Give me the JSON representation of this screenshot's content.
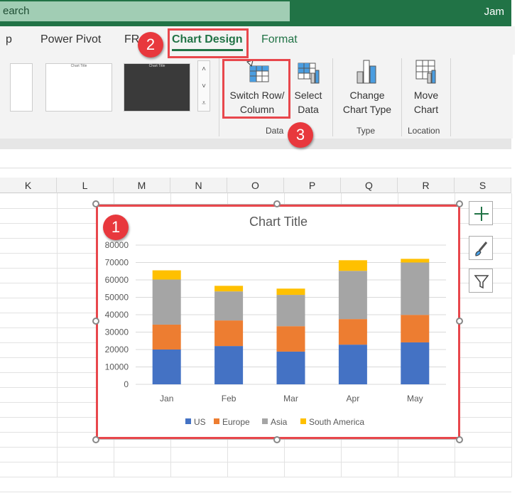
{
  "titlebar": {
    "search": "earch",
    "user": "Jam"
  },
  "tabs": [
    {
      "label": "p"
    },
    {
      "label": "Power Pivot"
    },
    {
      "label": "FR"
    },
    {
      "label": "Chart Design",
      "active": true
    },
    {
      "label": "Format"
    }
  ],
  "ribbon": {
    "buttons": [
      {
        "label1": "Switch Row/",
        "label2": "Column",
        "icon": "switch-row-column-icon"
      },
      {
        "label1": "Select",
        "label2": "Data",
        "icon": "select-data-icon"
      },
      {
        "label1": "Change",
        "label2": "Chart Type",
        "icon": "change-chart-type-icon"
      },
      {
        "label1": "Move",
        "label2": "Chart",
        "icon": "move-chart-icon"
      }
    ],
    "groups": [
      "Data",
      "Type",
      "Location"
    ],
    "thumb_title": "Chart Title"
  },
  "badges": [
    "1",
    "2",
    "3"
  ],
  "columns": [
    "K",
    "L",
    "M",
    "N",
    "O",
    "P",
    "Q",
    "R",
    "S"
  ],
  "colors": {
    "accent": "#217346",
    "highlight": "#e8474c",
    "US": "#4472c4",
    "Europe": "#ed7d31",
    "Asia": "#a5a5a5",
    "South America": "#ffc000"
  },
  "chart_data": {
    "type": "bar",
    "stacked": true,
    "title": "Chart Title",
    "categories": [
      "Jan",
      "Feb",
      "Mar",
      "Apr",
      "May"
    ],
    "series": [
      {
        "name": "US",
        "values": [
          20000,
          22000,
          18800,
          22800,
          24100
        ]
      },
      {
        "name": "Europe",
        "values": [
          14300,
          14700,
          14600,
          14700,
          15800
        ]
      },
      {
        "name": "Asia",
        "values": [
          25900,
          16700,
          18000,
          27700,
          30100
        ]
      },
      {
        "name": "South America",
        "values": [
          5300,
          3200,
          3600,
          6100,
          2100
        ]
      }
    ],
    "yticks": [
      "0",
      "10000",
      "20000",
      "30000",
      "40000",
      "50000",
      "60000",
      "70000",
      "80000"
    ],
    "ylim": [
      0,
      80000
    ],
    "grid": true,
    "legend": "bottom"
  },
  "chart_buttons": [
    "chart-elements-icon",
    "chart-styles-icon",
    "chart-filters-icon"
  ]
}
